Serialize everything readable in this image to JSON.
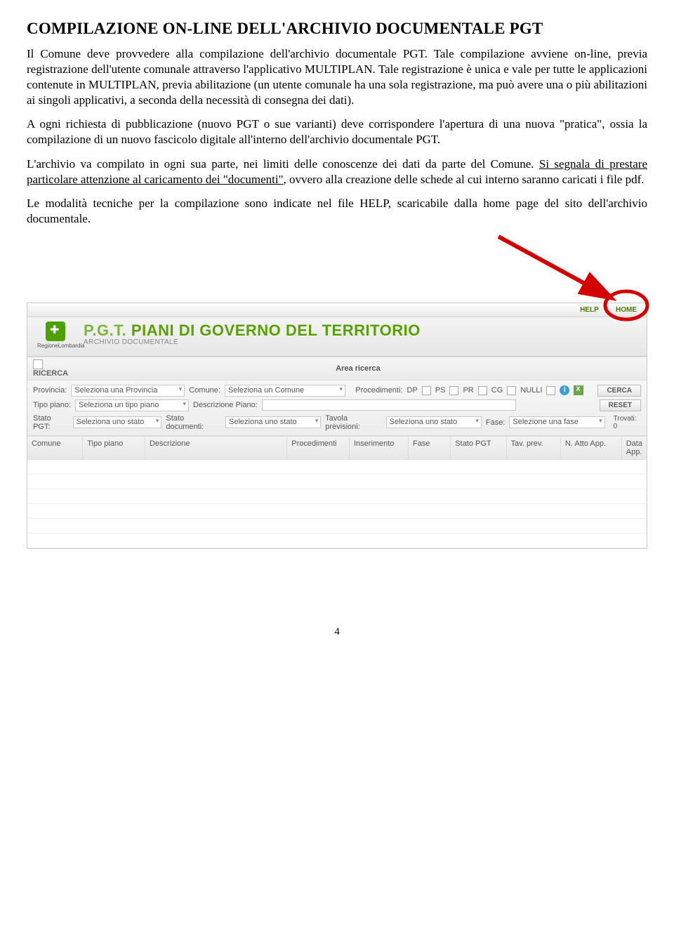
{
  "heading_pre": "C",
  "heading_mid1": "OMPILAZIONE ON",
  "heading_dash": "-",
  "heading_mid2": "LINE DELL",
  "heading_apos": "'",
  "heading_mid3": "ARCHIVIO DOCUMENTALE ",
  "heading_end": "PGT",
  "p1": "Il Comune deve provvedere alla compilazione dell'archivio documentale PGT. Tale compilazione avviene on-line, previa registrazione dell'utente comunale attraverso l'applicativo MULTIPLAN. Tale registrazione è unica e vale per tutte le applicazioni contenute in MULTIPLAN, previa abilitazione (un utente comunale ha una sola registrazione, ma può avere una o più abilitazioni ai singoli applicativi, a seconda della necessità di consegna dei dati).",
  "p2": "A ogni richiesta di pubblicazione (nuovo PGT o sue varianti) deve corrispondere l'apertura di una nuova \"pratica\", ossia la compilazione di un nuovo fascicolo digitale all'interno dell'archivio documentale PGT.",
  "p3a": "L'archivio va compilato in ogni sua parte, nei limiti delle conoscenze dei dati da parte del Comune. ",
  "p3u": "Si segnala di prestare particolare attenzione al caricamento dei \"documenti\"",
  "p3b": ", ovvero alla creazione delle schede al cui interno saranno caricati i file pdf.",
  "p4": "Le modalità tecniche per la compilazione sono indicate nel file HELP, scaricabile dalla home page del sito dell'archivio documentale.",
  "app": {
    "toplinks": {
      "help": "HELP",
      "home": "HOME",
      "sep": "|"
    },
    "logo": {
      "regione": "RegioneLombardia"
    },
    "title": {
      "pgt": "P.G.T.",
      "rest": " PIANI DI GOVERNO DEL TERRITORIO",
      "sub": "ARCHIVIO DOCUMENTALE"
    },
    "section": {
      "ricerca": "RICERCA",
      "area": "Area ricerca"
    },
    "filters": {
      "provincia_lbl": "Provincia:",
      "provincia_ph": "Seleziona una Provincia",
      "comune_lbl": "Comune:",
      "comune_ph": "Seleziona un Comune",
      "procedimenti_lbl": "Procedimenti:",
      "proc_dp": "DP",
      "proc_ps": "PS",
      "proc_pr": "PR",
      "proc_cg": "CG",
      "proc_nulli": "NULLI",
      "cerca": "CERCA",
      "tipo_piano_lbl": "Tipo piano:",
      "tipo_piano_ph": "Seleziona un tipo piano",
      "descr_lbl": "Descrizione Piano:",
      "reset": "RESET",
      "stato_pgt_lbl": "Stato PGT:",
      "stato_pgt_ph": "Seleziona uno stato",
      "stato_doc_lbl": "Stato documenti:",
      "stato_doc_ph": "Seleziona uno stato",
      "tavola_lbl": "Tavola previsioni:",
      "tavola_ph": "Seleziona uno stato",
      "fase_lbl": "Fase:",
      "fase_ph": "Selezione una fase",
      "trovati": "Trovati: 0"
    },
    "cols": {
      "c1": "Comune",
      "c2": "Tipo piano",
      "c3": "Descrizione",
      "c4": "Procedimenti",
      "c5": "Inserimento",
      "c6": "Fase",
      "c7": "Stato PGT",
      "c8": "Tav. prev.",
      "c9": "N. Atto App.",
      "c10": "Data App."
    }
  },
  "pagenum": "4"
}
